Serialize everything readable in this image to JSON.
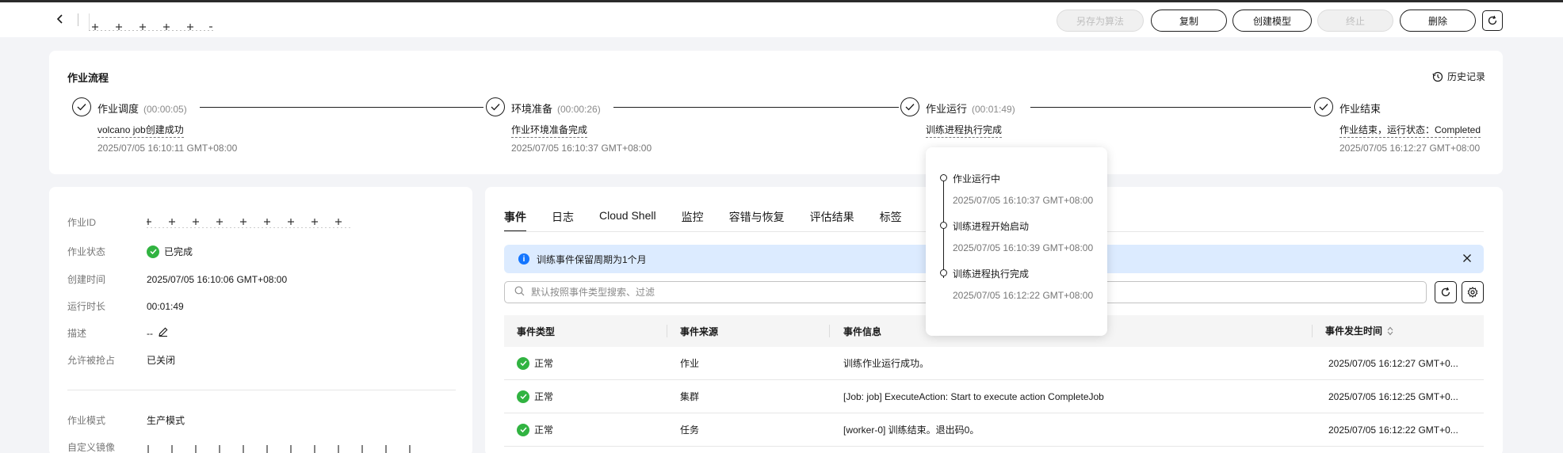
{
  "header": {
    "buttons": {
      "save_algorithm": "另存为算法",
      "copy": "复制",
      "create_model": "创建模型",
      "stop": "终止",
      "delete": "删除"
    }
  },
  "flow": {
    "title": "作业流程",
    "history_label": "历史记录",
    "stages": [
      {
        "name": "作业调度",
        "duration": "(00:00:05)",
        "message": "volcano job创建成功",
        "time": "2025/07/05 16:10:11 GMT+08:00"
      },
      {
        "name": "环境准备",
        "duration": "(00:00:26)",
        "message": "作业环境准备完成",
        "time": "2025/07/05 16:10:37 GMT+08:00"
      },
      {
        "name": "作业运行",
        "duration": "(00:01:49)",
        "message": "训练进程执行完成",
        "time": ""
      },
      {
        "name": "作业结束",
        "duration": "",
        "message": "作业结束，运行状态：Completed",
        "time": "2025/07/05 16:12:27 GMT+08:00"
      }
    ]
  },
  "popover": {
    "items": [
      {
        "title": "作业运行中",
        "time": "2025/07/05 16:10:37 GMT+08:00"
      },
      {
        "title": "训练进程开始启动",
        "time": "2025/07/05 16:10:39 GMT+08:00"
      },
      {
        "title": "训练进程执行完成",
        "time": "2025/07/05 16:12:22 GMT+08:00"
      }
    ]
  },
  "info": {
    "job_id_label": "作业ID",
    "status_label": "作业状态",
    "status_value": "已完成",
    "created_label": "创建时间",
    "created_value": "2025/07/05 16:10:06 GMT+08:00",
    "duration_label": "运行时长",
    "duration_value": "00:01:49",
    "desc_label": "描述",
    "desc_value": "--",
    "preempt_label": "允许被抢占",
    "preempt_value": "已关闭",
    "mode_label": "作业模式",
    "mode_value": "生产模式",
    "image_label": "自定义镜像"
  },
  "events": {
    "tabs": [
      "事件",
      "日志",
      "Cloud Shell",
      "监控",
      "容错与恢复",
      "评估结果",
      "标签"
    ],
    "notice": "训练事件保留周期为1个月",
    "search_placeholder": "默认按照事件类型搜索、过滤",
    "columns": [
      "事件类型",
      "事件来源",
      "事件信息",
      "事件发生时间"
    ],
    "rows": [
      {
        "type": "正常",
        "source": "作业",
        "info": "训练作业运行成功。",
        "time": "2025/07/05 16:12:27 GMT+0..."
      },
      {
        "type": "正常",
        "source": "集群",
        "info": "[Job: job] ExecuteAction: Start to execute action CompleteJob",
        "time": "2025/07/05 16:12:25 GMT+0..."
      },
      {
        "type": "正常",
        "source": "任务",
        "info": "[worker-0] 训练结束。退出码0。",
        "time": "2025/07/05 16:12:22 GMT+0..."
      }
    ]
  },
  "colors": {
    "accent": "#1476ff",
    "success": "#31b341",
    "notice_bg": "#dcebff"
  }
}
